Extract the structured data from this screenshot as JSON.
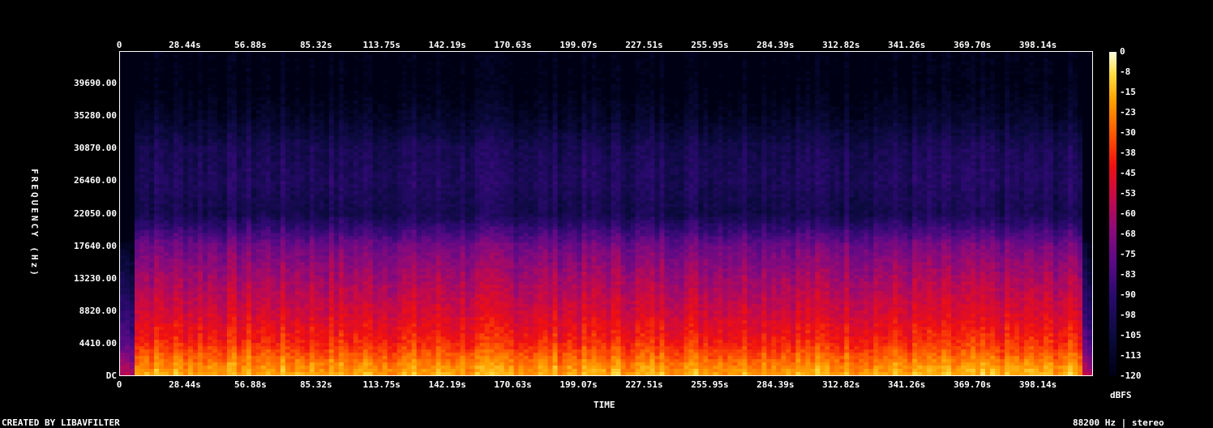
{
  "chart_data": {
    "type": "heatmap",
    "title": "",
    "xlabel": "TIME",
    "ylabel": "FREQUENCY (Hz)",
    "x_ticks": [
      "0",
      "28.44s",
      "56.88s",
      "85.32s",
      "113.75s",
      "142.19s",
      "170.63s",
      "199.07s",
      "227.51s",
      "255.95s",
      "284.39s",
      "312.82s",
      "341.26s",
      "369.70s",
      "398.14s"
    ],
    "y_ticks": [
      "DC",
      "4410.00",
      "8820.00",
      "13230.00",
      "17640.00",
      "22050.00",
      "26460.00",
      "30870.00",
      "35280.00",
      "39690.00"
    ],
    "colorbar": {
      "label": "dBFS",
      "ticks": [
        "0",
        "-8",
        "-15",
        "-23",
        "-30",
        "-38",
        "-45",
        "-53",
        "-60",
        "-68",
        "-75",
        "-83",
        "-90",
        "-98",
        "-105",
        "-113",
        "-120"
      ],
      "range": [
        -120,
        0
      ]
    },
    "xlim_seconds": [
      0,
      422
    ],
    "ylim_hz": [
      0,
      44100
    ],
    "energy_profile": [
      {
        "freq_hz": 0,
        "level_dbfs": -15
      },
      {
        "freq_hz": 4410,
        "level_dbfs": -38
      },
      {
        "freq_hz": 8820,
        "level_dbfs": -50
      },
      {
        "freq_hz": 13230,
        "level_dbfs": -60
      },
      {
        "freq_hz": 17640,
        "level_dbfs": -72
      },
      {
        "freq_hz": 22050,
        "level_dbfs": -100
      },
      {
        "freq_hz": 26460,
        "level_dbfs": -95
      },
      {
        "freq_hz": 30870,
        "level_dbfs": -98
      },
      {
        "freq_hz": 35280,
        "level_dbfs": -112
      },
      {
        "freq_hz": 39690,
        "level_dbfs": -120
      }
    ]
  },
  "footer": {
    "left": "CREATED BY LIBAVFILTER",
    "right": "88200 Hz | stereo"
  },
  "colors": {
    "background": "#000000",
    "axis": "#ffffff"
  }
}
